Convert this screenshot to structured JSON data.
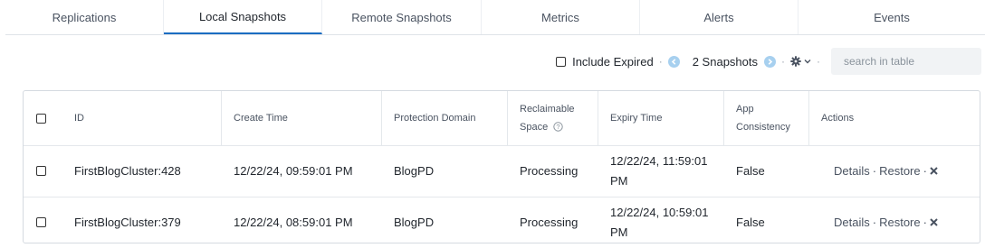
{
  "tabs": [
    {
      "label": "Replications"
    },
    {
      "label": "Local Snapshots",
      "active": true
    },
    {
      "label": "Remote Snapshots"
    },
    {
      "label": "Metrics"
    },
    {
      "label": "Alerts"
    },
    {
      "label": "Events"
    }
  ],
  "toolbar": {
    "include_expired_label": "Include Expired",
    "include_expired_checked": false,
    "snapshot_count": "2 Snapshots",
    "search_placeholder": "search in table"
  },
  "table": {
    "headers": {
      "id": "ID",
      "create_time": "Create Time",
      "protection_domain": "Protection Domain",
      "reclaimable_space_line1": "Reclaimable",
      "reclaimable_space_line2": "Space",
      "expiry_time": "Expiry Time",
      "app_consistency_line1": "App",
      "app_consistency_line2": "Consistency",
      "actions": "Actions"
    },
    "rows": [
      {
        "id": "FirstBlogCluster:428",
        "create_time": "12/22/24, 09:59:01 PM",
        "protection_domain": "BlogPD",
        "reclaimable_space": "Processing",
        "expiry_time_line1": "12/22/24, 11:59:01",
        "expiry_time_line2": "PM",
        "app_consistency": "False",
        "action_details": "Details",
        "action_restore": "Restore"
      },
      {
        "id": "FirstBlogCluster:379",
        "create_time": "12/22/24, 08:59:01 PM",
        "protection_domain": "BlogPD",
        "reclaimable_space": "Processing",
        "expiry_time_line1": "12/22/24, 10:59:01",
        "expiry_time_line2": "PM",
        "app_consistency": "False",
        "action_details": "Details",
        "action_restore": "Restore"
      }
    ]
  },
  "colors": {
    "accent": "#1b6dc1",
    "pager_arrow": "#a7d0ef",
    "search_bg": "#f1f3f5"
  }
}
